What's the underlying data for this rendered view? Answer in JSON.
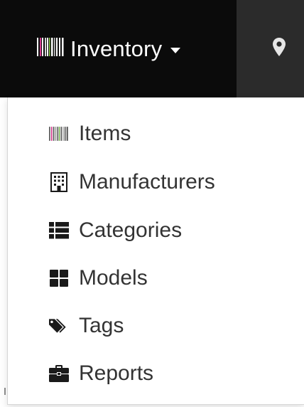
{
  "navbar": {
    "inventory_label": "Inventory",
    "inventory_icon": "barcode-icon",
    "location_icon": "map-marker-icon",
    "colors": {
      "bar": "#0b0b0b",
      "location_bg": "#2b2b2b",
      "text": "#ffffff"
    }
  },
  "dropdown": {
    "items": [
      {
        "label": "Items",
        "icon": "barcode-icon"
      },
      {
        "label": "Manufacturers",
        "icon": "building-icon"
      },
      {
        "label": "Categories",
        "icon": "list-icon"
      },
      {
        "label": "Models",
        "icon": "th-large-icon"
      },
      {
        "label": "Tags",
        "icon": "tags-icon"
      },
      {
        "label": "Reports",
        "icon": "briefcase-icon"
      }
    ],
    "colors": {
      "text": "#333333",
      "icon": "#1a1a1a"
    }
  }
}
